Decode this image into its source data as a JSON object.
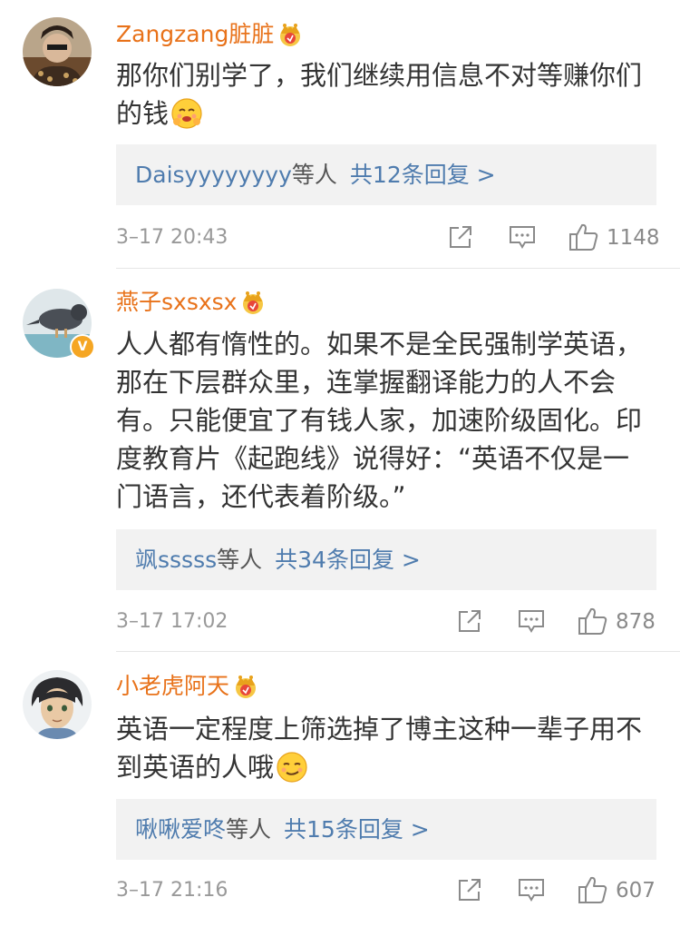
{
  "comments": [
    {
      "username": "Zangzang脏脏",
      "text": "那你们别学了，我们继续用信息不对等赚你们的钱",
      "reply_names": "Daisyyyyyyyy",
      "reply_deng": "等人",
      "reply_count": "共12条回复 >",
      "time": "3–17 20:43",
      "likes": "1148",
      "verified": false
    },
    {
      "username": "燕子sxsxsx",
      "text": "人人都有惰性的。如果不是全民强制学英语，那在下层群众里，连掌握翻译能力的人不会有。只能便宜了有钱人家，加速阶级固化。印度教育片《起跑线》说得好：“英语不仅是一门语言，还代表着阶级。”",
      "reply_names": "飒sssss",
      "reply_deng": "等人",
      "reply_count": "共34条回复 >",
      "time": "3–17 17:02",
      "likes": "878",
      "verified": true,
      "verified_mark": "V"
    },
    {
      "username": "小老虎阿天",
      "text": "英语一定程度上筛选掉了博主这种一辈子用不到英语的人哦",
      "reply_names": "啾啾爱咚",
      "reply_deng": "等人",
      "reply_count": "共15条回复 >",
      "time": "3–17 21:16",
      "likes": "607",
      "verified": false
    }
  ],
  "icons": {
    "share": "share-icon",
    "comment": "comment-icon",
    "like": "thumbs-up-icon",
    "crown": "crown-badge-icon",
    "emoji1": "smiling-hug-emoji-icon",
    "emoji2": "smirk-emoji-icon"
  },
  "colors": {
    "username": "#e8721a",
    "reply_link": "#4f7cae",
    "meta": "#999999",
    "reply_bg": "#f2f2f2"
  }
}
